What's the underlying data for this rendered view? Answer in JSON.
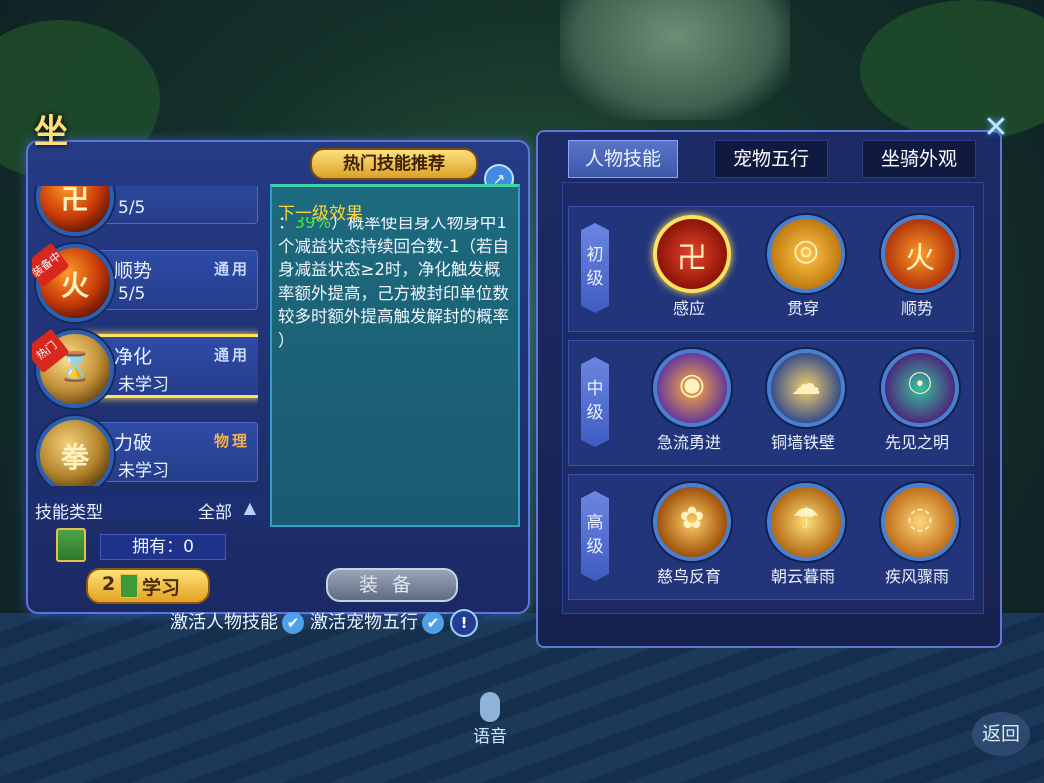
{
  "colors": {
    "accent_gold": "#ffe25a",
    "panel_blue": "#263b86",
    "desc_teal": "#1d6a7e",
    "green_value": "#4ee14a"
  },
  "header": {
    "seat_char": "坐",
    "hot_banner": "热门技能推荐"
  },
  "skills": [
    {
      "name": "",
      "level": "5/5",
      "tag": "",
      "ribbon": "",
      "icon": "flame-sigil-icon",
      "glyph": "卍"
    },
    {
      "name": "顺势",
      "level": "5/5",
      "tag": "通用",
      "ribbon": "装备中",
      "icon": "flame-fist-icon",
      "glyph": "火"
    },
    {
      "name": "净化",
      "level": "未学习",
      "tag": "通用",
      "ribbon": "热门",
      "icon": "hourglass-icon",
      "glyph": "⌛"
    },
    {
      "name": "力破",
      "level": "未学习",
      "tag": "物理",
      "ribbon": "",
      "icon": "strength-fist-icon",
      "glyph": "拳"
    }
  ],
  "skill_type": {
    "label": "技能类型",
    "value": "全部"
  },
  "owned": {
    "text": "拥有：0"
  },
  "learn_button": {
    "count": "2",
    "label": "学习"
  },
  "equip_button": {
    "label": "装备"
  },
  "description": {
    "title": "下一级效果",
    "prefix": "：",
    "highlight": "39%",
    "body": "）概率使自身人物身中1个减益状态持续回合数-1（若自身减益状态≥2时，净化触发概率额外提高，己方被封印单位数较多时额外提高触发解封的概率 ）"
  },
  "tabs": [
    {
      "label": "人物技能",
      "active": true
    },
    {
      "label": "宠物五行",
      "active": false
    },
    {
      "label": "坐骑外观",
      "active": false
    }
  ],
  "tiers": [
    {
      "label": "初级",
      "skills": [
        {
          "name": "感应",
          "glyph": "卍",
          "active": true
        },
        {
          "name": "贯穿",
          "glyph": "◎",
          "active": false
        },
        {
          "name": "顺势",
          "glyph": "火",
          "active": false
        }
      ]
    },
    {
      "label": "中级",
      "skills": [
        {
          "name": "急流勇进",
          "glyph": "◉",
          "active": false
        },
        {
          "name": "铜墙铁壁",
          "glyph": "☁",
          "active": false
        },
        {
          "name": "先见之明",
          "glyph": "☉",
          "active": false
        }
      ]
    },
    {
      "label": "高级",
      "skills": [
        {
          "name": "慈鸟反育",
          "glyph": "✿",
          "active": false
        },
        {
          "name": "朝云暮雨",
          "glyph": "☂",
          "active": false
        },
        {
          "name": "疾风骤雨",
          "glyph": "◌",
          "active": false
        }
      ]
    }
  ],
  "activate": {
    "person": "激活人物技能",
    "pet": "激活宠物五行"
  },
  "footer": {
    "voice": "语音",
    "back": "返回"
  }
}
